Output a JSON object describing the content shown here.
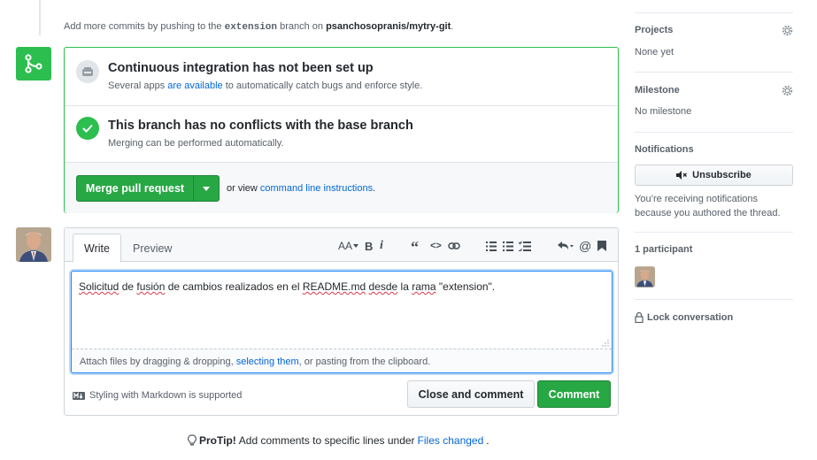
{
  "top_note": {
    "prefix": "Add more commits by pushing to the ",
    "branch": "extension",
    "middle": " branch on ",
    "repo": "psanchosopranis/mytry-git",
    "suffix": "."
  },
  "merge": {
    "ci_title": "Continuous integration has not been set up",
    "ci_sub_prefix": "Several apps ",
    "ci_sub_link": "are available",
    "ci_sub_suffix": " to automatically catch bugs and enforce style.",
    "conflict_title": "This branch has no conflicts with the base branch",
    "conflict_sub": "Merging can be performed automatically.",
    "merge_button": "Merge pull request",
    "or_view": "or view ",
    "cli_link": "command line instructions",
    "cli_suffix": "."
  },
  "comment": {
    "tab_write": "Write",
    "tab_preview": "Preview",
    "toolbar": {
      "heading": "AA",
      "bold": "B",
      "italic": "i",
      "quote": "“",
      "code": "<>"
    },
    "text_words": [
      "Solicitud",
      " de ",
      "fusión",
      " de cambios realizados en el ",
      "README.md",
      " ",
      "desde",
      " la ",
      "rama",
      " \"extension\"."
    ],
    "attach_prefix": "Attach files by dragging & dropping, ",
    "attach_link": "selecting them",
    "attach_suffix": ", or pasting from the clipboard.",
    "markdown_note": "Styling with Markdown is supported",
    "close_button": "Close and comment",
    "comment_button": "Comment"
  },
  "protip": {
    "label": "ProTip!",
    "text": " Add comments to specific lines under ",
    "link": "Files changed",
    "suffix": "."
  },
  "sidebar": {
    "projects_title": "Projects",
    "projects_value": "None yet",
    "milestone_title": "Milestone",
    "milestone_value": "No milestone",
    "notifications_title": "Notifications",
    "unsubscribe": "Unsubscribe",
    "notifications_reason": "You’re receiving notifications because you authored the thread.",
    "participants_title": "1 participant",
    "lock": "Lock conversation"
  },
  "colors": {
    "accent_green": "#2cbe4e",
    "link_blue": "#0366d6"
  }
}
